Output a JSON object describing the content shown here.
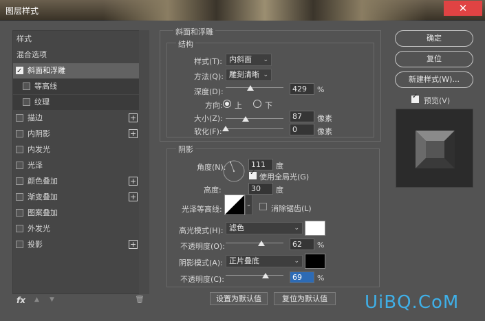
{
  "window": {
    "title": "图层样式",
    "close_glyph": "✕"
  },
  "left_panel": {
    "items": [
      {
        "label": "样式",
        "checkbox": false
      },
      {
        "label": "混合选项",
        "checkbox": false
      },
      {
        "label": "斜面和浮雕",
        "checkbox": true,
        "checked": true,
        "selected": true
      },
      {
        "label": "等高线",
        "checkbox": true,
        "checked": false,
        "sub": true
      },
      {
        "label": "纹理",
        "checkbox": true,
        "checked": false,
        "sub": true
      },
      {
        "label": "描边",
        "checkbox": true,
        "checked": false,
        "plus": true
      },
      {
        "label": "内阴影",
        "checkbox": true,
        "checked": false,
        "plus": true
      },
      {
        "label": "内发光",
        "checkbox": true,
        "checked": false
      },
      {
        "label": "光泽",
        "checkbox": true,
        "checked": false
      },
      {
        "label": "颜色叠加",
        "checkbox": true,
        "checked": false,
        "plus": true
      },
      {
        "label": "渐变叠加",
        "checkbox": true,
        "checked": false,
        "plus": true
      },
      {
        "label": "图案叠加",
        "checkbox": true,
        "checked": false
      },
      {
        "label": "外发光",
        "checkbox": true,
        "checked": false
      },
      {
        "label": "投影",
        "checkbox": true,
        "checked": false,
        "plus": true
      }
    ],
    "plus_glyph": "+",
    "bottom": {
      "fx": "fx",
      "up_glyph": "▲",
      "down_glyph": "▼",
      "trash_glyph": "🗑"
    }
  },
  "bevel": {
    "section_title": "斜面和浮雕",
    "structure_title": "结构",
    "style_label": "样式(T):",
    "style_value": "内斜面",
    "technique_label": "方法(Q):",
    "technique_value": "雕刻清晰",
    "depth_label": "深度(D):",
    "depth_value": "429",
    "depth_fraction": 0.43,
    "direction_label": "方向:",
    "direction_up": "上",
    "direction_down": "下",
    "size_label": "大小(Z):",
    "size_value": "87",
    "size_fraction": 0.35,
    "soften_label": "软化(F):",
    "soften_value": "0",
    "soften_fraction": 0.0,
    "percent": "%",
    "px_unit": "像素"
  },
  "shading": {
    "title": "阴影",
    "angle_label": "角度(N):",
    "angle_value": "111",
    "deg": "度",
    "global_light_label": "使用全局光(G)",
    "altitude_label": "高度:",
    "altitude_value": "30",
    "gloss_label": "光泽等高线:",
    "antialias_label": "消除锯齿(L)",
    "highlight_mode_label": "高光模式(H):",
    "highlight_mode_value": "滤色",
    "highlight_color": "#ffffff",
    "highlight_opacity_label": "不透明度(O):",
    "highlight_opacity_value": "62",
    "highlight_opacity_fraction": 0.62,
    "shadow_mode_label": "阴影模式(A):",
    "shadow_mode_value": "正片叠底",
    "shadow_color": "#000000",
    "shadow_opacity_label": "不透明度(C):",
    "shadow_opacity_value": "69",
    "shadow_opacity_fraction": 0.69,
    "percent": "%"
  },
  "bottom_buttons": {
    "make_default": "设置为默认值",
    "reset_default": "复位为默认值"
  },
  "right_buttons": {
    "ok": "确定",
    "reset": "复位",
    "new_style": "新建样式(W)...",
    "preview_label": "预览(V)"
  },
  "watermark": "UiBQ.CoM",
  "colors": {
    "accent_watermark": "#3fb0e8",
    "close_red": "#e04343"
  }
}
